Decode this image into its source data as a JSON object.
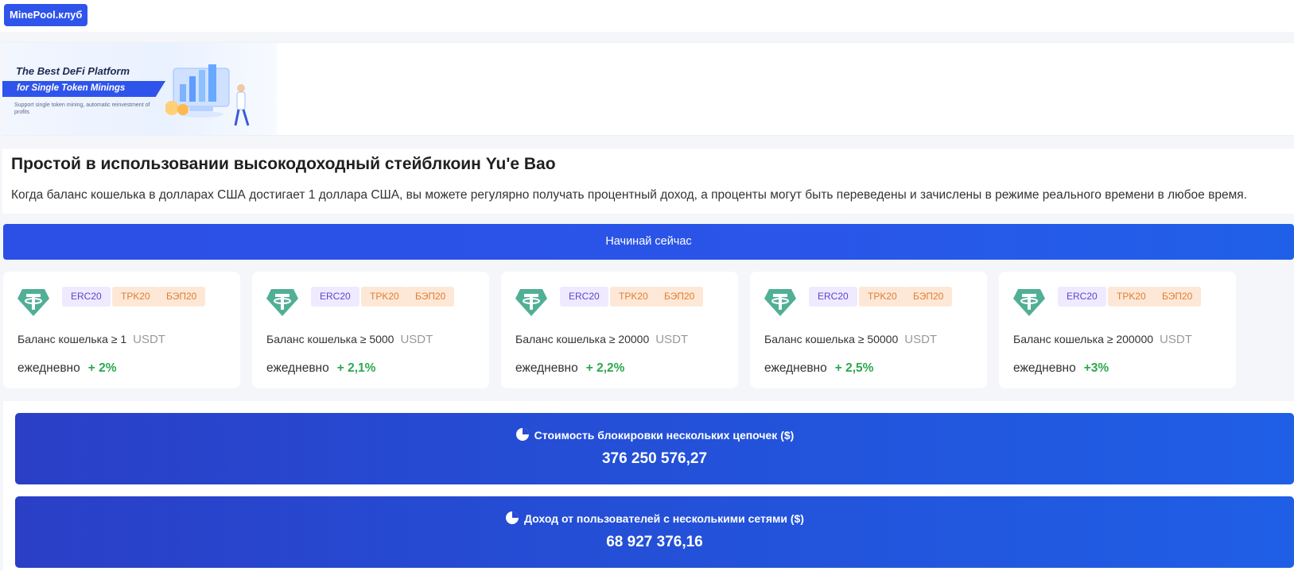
{
  "header": {
    "logo_label": "MinePool.клуб"
  },
  "banner": {
    "title": "The Best DeFi Platform",
    "ribbon": "for Single Token Minings",
    "note": "Support single token mining, automatic reinvestment of profits"
  },
  "intro": {
    "title": "Простой в использовании высокодоходный стейблкоин Yu'e Bao",
    "description": "Когда баланс кошелька в долларах США достигает 1 доллара США, вы можете регулярно получать процентный доход, а проценты могут быть переведены и зачислены в режиме реального времени в любое время."
  },
  "start_button": {
    "label": "Начинай сейчас"
  },
  "cards": [
    {
      "tags": [
        "ERC20",
        "TPK20",
        "БЭП20"
      ],
      "balance_label": "Баланс кошелька ≥ 1",
      "unit": "USDT",
      "daily_label": "ежедневно",
      "rate": "+ 2%"
    },
    {
      "tags": [
        "ERC20",
        "TPK20",
        "БЭП20"
      ],
      "balance_label": "Баланс кошелька ≥ 5000",
      "unit": "USDT",
      "daily_label": "ежедневно",
      "rate": "+ 2,1%"
    },
    {
      "tags": [
        "ERC20",
        "TPK20",
        "БЭП20"
      ],
      "balance_label": "Баланс кошелька ≥ 20000",
      "unit": "USDT",
      "daily_label": "ежедневно",
      "rate": "+ 2,2%"
    },
    {
      "tags": [
        "ERC20",
        "TPK20",
        "БЭП20"
      ],
      "balance_label": "Баланс кошелька ≥ 50000",
      "unit": "USDT",
      "daily_label": "ежедневно",
      "rate": "+ 2,5%"
    },
    {
      "tags": [
        "ERC20",
        "TPK20",
        "БЭП20"
      ],
      "balance_label": "Баланс кошелька ≥ 200000",
      "unit": "USDT",
      "daily_label": "ежедневно",
      "rate": "+3%"
    }
  ],
  "stats": [
    {
      "label": "Стоимость блокировки нескольких цепочек ($)",
      "value": "376 250 576,27",
      "icon": "pie-chart-icon"
    },
    {
      "label": "Доход от пользователей с несколькими сетями ($)",
      "value": "68 927 376,16",
      "icon": "pie-chart-icon"
    }
  ],
  "colors": {
    "accent": "#2f54eb",
    "positive": "#2da84f",
    "tether": "#50af95"
  }
}
